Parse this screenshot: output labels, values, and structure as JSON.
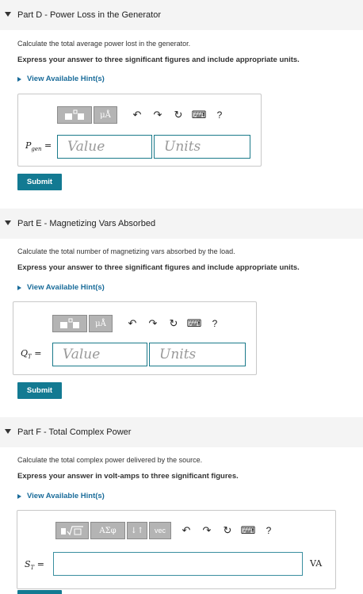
{
  "partD": {
    "label": "Part D",
    "title": " - Power Loss in the Generator",
    "question": "Calculate the total average power lost in the generator.",
    "instruction": "Express your answer to three significant figures and include appropriate units.",
    "hint": "View Available Hint(s)",
    "var": "P",
    "var_sub": "gen",
    "equals": "=",
    "value_placeholder": "Value",
    "units_placeholder": "Units",
    "submit": "Submit"
  },
  "partE": {
    "label": "Part E",
    "title": " - Magnetizing Vars Absorbed",
    "question": "Calculate the total number of magnetizing vars absorbed by the load.",
    "instruction": "Express your answer to three significant figures and include appropriate units.",
    "hint": "View Available Hint(s)",
    "var": "Q",
    "var_sub": "T",
    "equals": "=",
    "value_placeholder": "Value",
    "units_placeholder": "Units",
    "submit": "Submit"
  },
  "partF": {
    "label": "Part F",
    "title": " - Total Complex Power",
    "question": "Calculate the total complex power delivered by the source.",
    "instruction": "Express your answer in volt-amps to three significant figures.",
    "hint": "View Available Hint(s)",
    "var": "S",
    "var_sub": "T",
    "equals": "=",
    "unit": "VA"
  },
  "toolbar": {
    "mu": "μÅ",
    "sym": "ΑΣφ",
    "arrows": "↓↑",
    "vec": "vec",
    "undo": "↶",
    "redo": "↷",
    "reset": "↻",
    "keyboard": "⌨",
    "help": "?"
  },
  "icons": {
    "grid": "templates-icon",
    "sqrt": "sqrt-templates-icon"
  }
}
